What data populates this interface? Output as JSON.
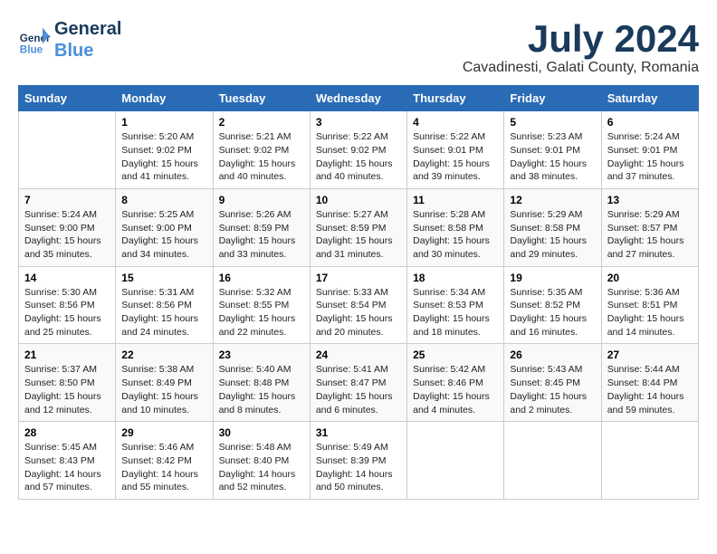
{
  "logo": {
    "line1": "General",
    "line2": "Blue"
  },
  "title": "July 2024",
  "subtitle": "Cavadinesti, Galati County, Romania",
  "weekdays": [
    "Sunday",
    "Monday",
    "Tuesday",
    "Wednesday",
    "Thursday",
    "Friday",
    "Saturday"
  ],
  "weeks": [
    [
      {
        "day": "",
        "info": ""
      },
      {
        "day": "1",
        "info": "Sunrise: 5:20 AM\nSunset: 9:02 PM\nDaylight: 15 hours\nand 41 minutes."
      },
      {
        "day": "2",
        "info": "Sunrise: 5:21 AM\nSunset: 9:02 PM\nDaylight: 15 hours\nand 40 minutes."
      },
      {
        "day": "3",
        "info": "Sunrise: 5:22 AM\nSunset: 9:02 PM\nDaylight: 15 hours\nand 40 minutes."
      },
      {
        "day": "4",
        "info": "Sunrise: 5:22 AM\nSunset: 9:01 PM\nDaylight: 15 hours\nand 39 minutes."
      },
      {
        "day": "5",
        "info": "Sunrise: 5:23 AM\nSunset: 9:01 PM\nDaylight: 15 hours\nand 38 minutes."
      },
      {
        "day": "6",
        "info": "Sunrise: 5:24 AM\nSunset: 9:01 PM\nDaylight: 15 hours\nand 37 minutes."
      }
    ],
    [
      {
        "day": "7",
        "info": "Sunrise: 5:24 AM\nSunset: 9:00 PM\nDaylight: 15 hours\nand 35 minutes."
      },
      {
        "day": "8",
        "info": "Sunrise: 5:25 AM\nSunset: 9:00 PM\nDaylight: 15 hours\nand 34 minutes."
      },
      {
        "day": "9",
        "info": "Sunrise: 5:26 AM\nSunset: 8:59 PM\nDaylight: 15 hours\nand 33 minutes."
      },
      {
        "day": "10",
        "info": "Sunrise: 5:27 AM\nSunset: 8:59 PM\nDaylight: 15 hours\nand 31 minutes."
      },
      {
        "day": "11",
        "info": "Sunrise: 5:28 AM\nSunset: 8:58 PM\nDaylight: 15 hours\nand 30 minutes."
      },
      {
        "day": "12",
        "info": "Sunrise: 5:29 AM\nSunset: 8:58 PM\nDaylight: 15 hours\nand 29 minutes."
      },
      {
        "day": "13",
        "info": "Sunrise: 5:29 AM\nSunset: 8:57 PM\nDaylight: 15 hours\nand 27 minutes."
      }
    ],
    [
      {
        "day": "14",
        "info": "Sunrise: 5:30 AM\nSunset: 8:56 PM\nDaylight: 15 hours\nand 25 minutes."
      },
      {
        "day": "15",
        "info": "Sunrise: 5:31 AM\nSunset: 8:56 PM\nDaylight: 15 hours\nand 24 minutes."
      },
      {
        "day": "16",
        "info": "Sunrise: 5:32 AM\nSunset: 8:55 PM\nDaylight: 15 hours\nand 22 minutes."
      },
      {
        "day": "17",
        "info": "Sunrise: 5:33 AM\nSunset: 8:54 PM\nDaylight: 15 hours\nand 20 minutes."
      },
      {
        "day": "18",
        "info": "Sunrise: 5:34 AM\nSunset: 8:53 PM\nDaylight: 15 hours\nand 18 minutes."
      },
      {
        "day": "19",
        "info": "Sunrise: 5:35 AM\nSunset: 8:52 PM\nDaylight: 15 hours\nand 16 minutes."
      },
      {
        "day": "20",
        "info": "Sunrise: 5:36 AM\nSunset: 8:51 PM\nDaylight: 15 hours\nand 14 minutes."
      }
    ],
    [
      {
        "day": "21",
        "info": "Sunrise: 5:37 AM\nSunset: 8:50 PM\nDaylight: 15 hours\nand 12 minutes."
      },
      {
        "day": "22",
        "info": "Sunrise: 5:38 AM\nSunset: 8:49 PM\nDaylight: 15 hours\nand 10 minutes."
      },
      {
        "day": "23",
        "info": "Sunrise: 5:40 AM\nSunset: 8:48 PM\nDaylight: 15 hours\nand 8 minutes."
      },
      {
        "day": "24",
        "info": "Sunrise: 5:41 AM\nSunset: 8:47 PM\nDaylight: 15 hours\nand 6 minutes."
      },
      {
        "day": "25",
        "info": "Sunrise: 5:42 AM\nSunset: 8:46 PM\nDaylight: 15 hours\nand 4 minutes."
      },
      {
        "day": "26",
        "info": "Sunrise: 5:43 AM\nSunset: 8:45 PM\nDaylight: 15 hours\nand 2 minutes."
      },
      {
        "day": "27",
        "info": "Sunrise: 5:44 AM\nSunset: 8:44 PM\nDaylight: 14 hours\nand 59 minutes."
      }
    ],
    [
      {
        "day": "28",
        "info": "Sunrise: 5:45 AM\nSunset: 8:43 PM\nDaylight: 14 hours\nand 57 minutes."
      },
      {
        "day": "29",
        "info": "Sunrise: 5:46 AM\nSunset: 8:42 PM\nDaylight: 14 hours\nand 55 minutes."
      },
      {
        "day": "30",
        "info": "Sunrise: 5:48 AM\nSunset: 8:40 PM\nDaylight: 14 hours\nand 52 minutes."
      },
      {
        "day": "31",
        "info": "Sunrise: 5:49 AM\nSunset: 8:39 PM\nDaylight: 14 hours\nand 50 minutes."
      },
      {
        "day": "",
        "info": ""
      },
      {
        "day": "",
        "info": ""
      },
      {
        "day": "",
        "info": ""
      }
    ]
  ]
}
